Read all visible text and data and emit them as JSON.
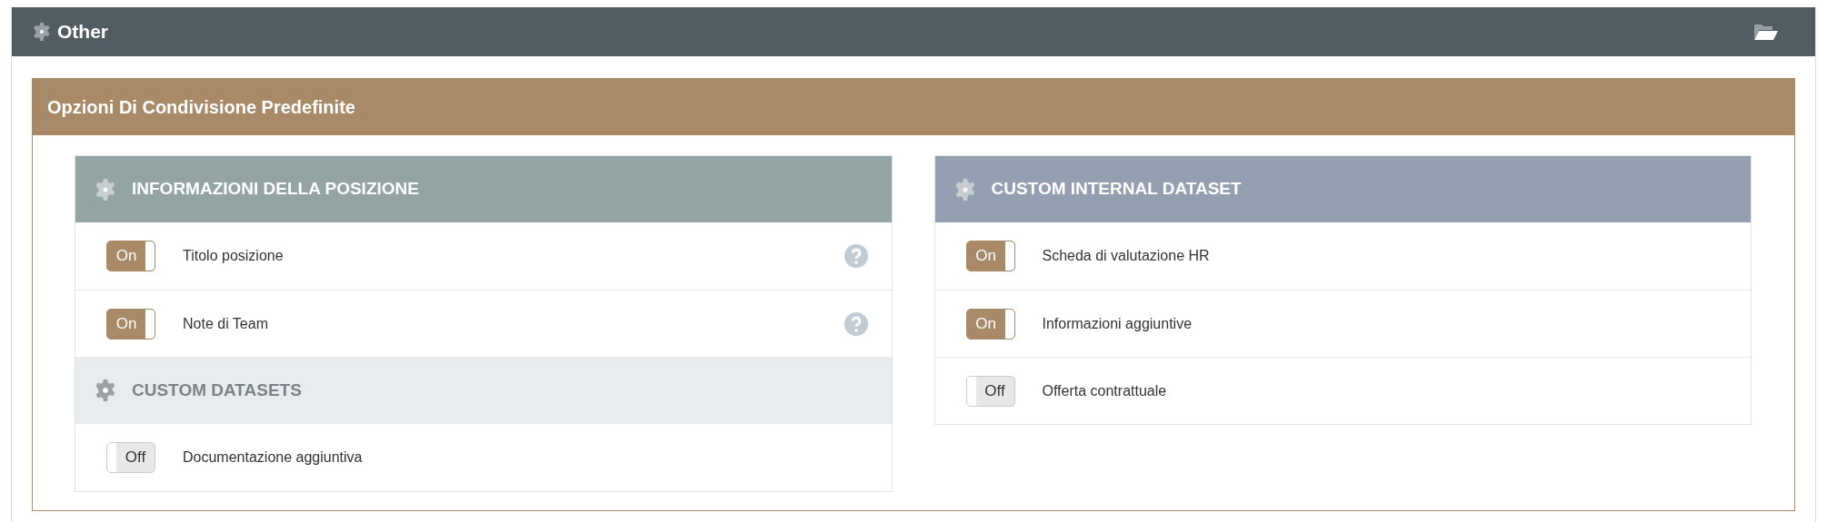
{
  "panel": {
    "title": "Other"
  },
  "section": {
    "title": "Opzioni Di Condivisione Predefinite"
  },
  "cards": [
    {
      "groups": [
        {
          "title": "INFORMAZIONI DELLA POSIZIONE",
          "kind": "main",
          "color": "#94a3a3",
          "rows": [
            {
              "label": "Titolo posizione",
              "on": true,
              "toggle_text": "On",
              "help": true
            },
            {
              "label": "Note di Team",
              "on": true,
              "toggle_text": "On",
              "help": true
            }
          ]
        },
        {
          "title": "CUSTOM DATASETS",
          "kind": "sub",
          "color": "#e9ecef",
          "rows": [
            {
              "label": "Documentazione aggiuntiva",
              "on": false,
              "toggle_text": "Off",
              "help": false
            }
          ]
        }
      ]
    },
    {
      "groups": [
        {
          "title": "CUSTOM INTERNAL DATASET",
          "kind": "main",
          "color": "#94a0b2",
          "rows": [
            {
              "label": "Scheda di valutazione HR",
              "on": true,
              "toggle_text": "On",
              "help": false
            },
            {
              "label": "Informazioni aggiuntive",
              "on": true,
              "toggle_text": "On",
              "help": false
            },
            {
              "label": "Offerta contrattuale",
              "on": false,
              "toggle_text": "Off",
              "help": false
            }
          ]
        }
      ]
    }
  ]
}
